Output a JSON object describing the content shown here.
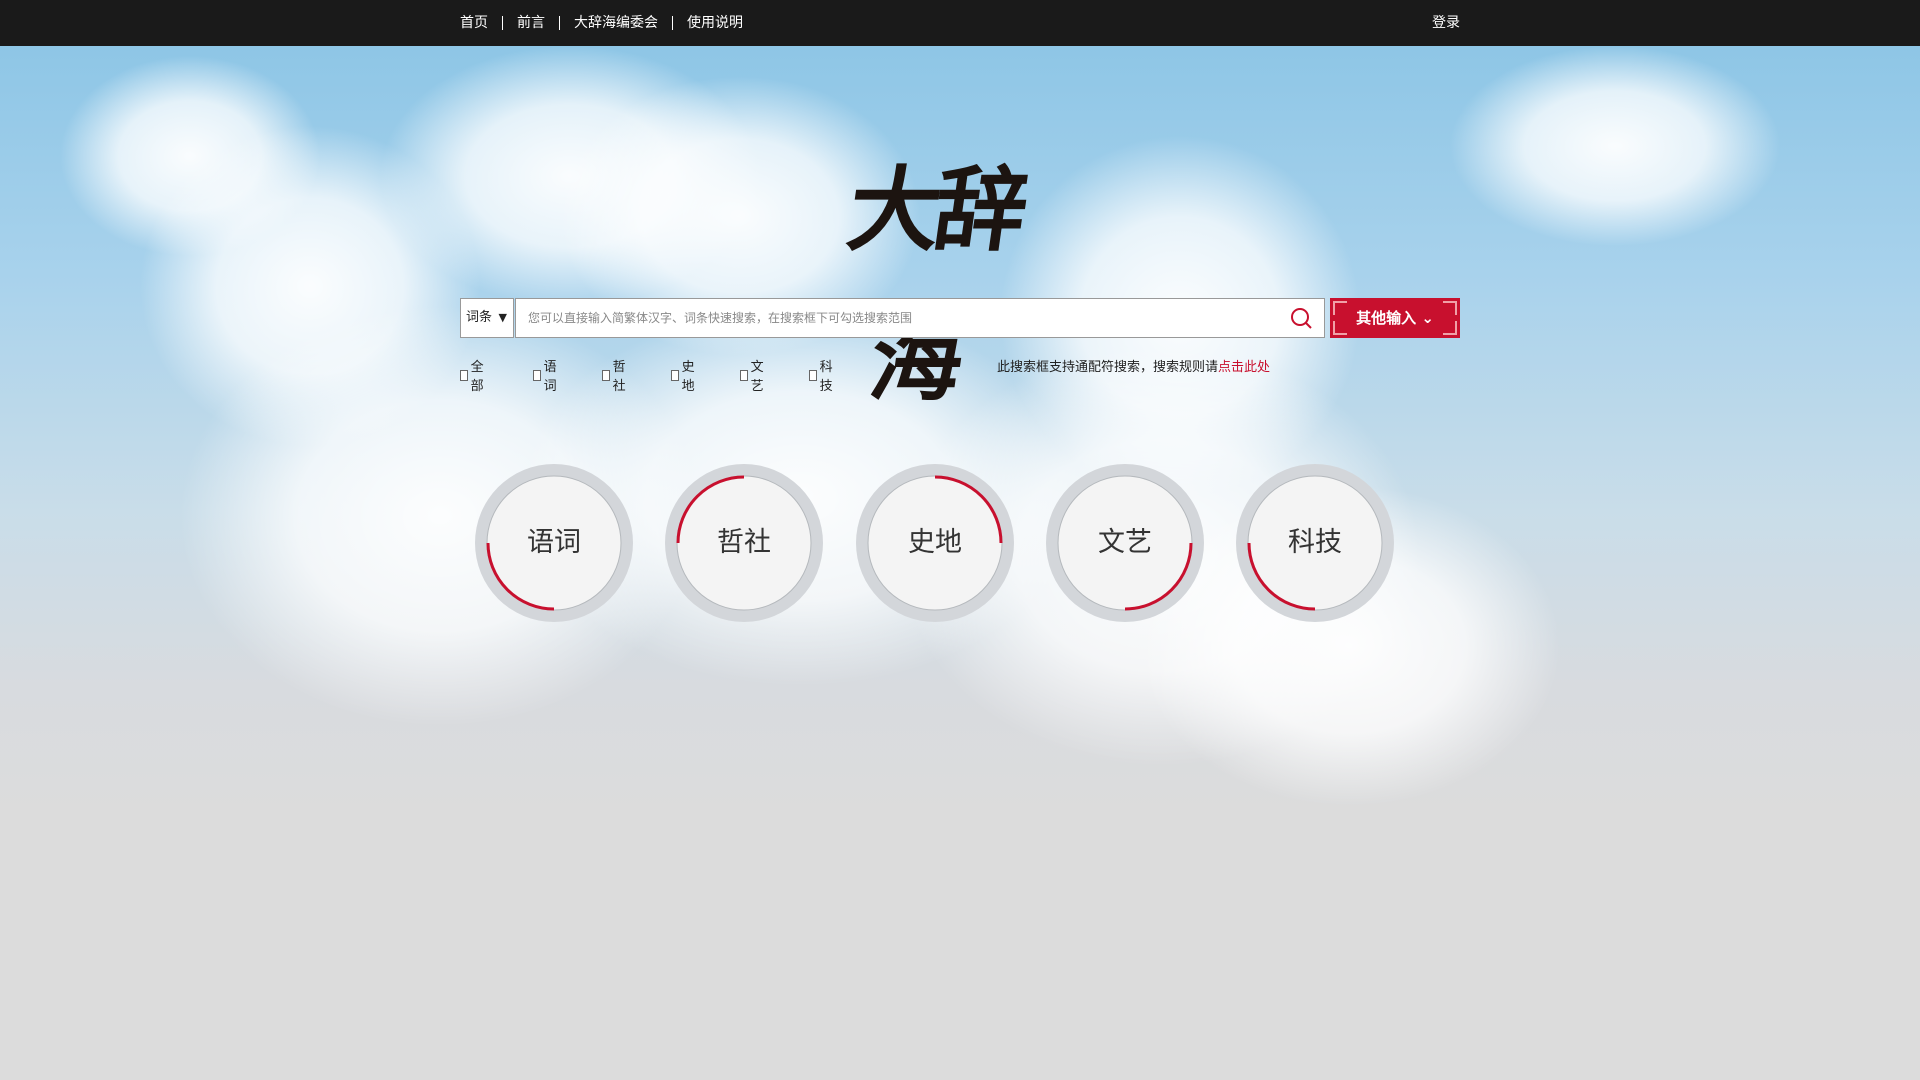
{
  "nav": {
    "items": [
      "首页",
      "前言",
      "大辞海编委会",
      "使用说明"
    ],
    "login": "登录"
  },
  "logo": {
    "text": "大辞海"
  },
  "search": {
    "scope_value": "词条",
    "placeholder": "您可以直接输入简繁体汉字、词条快速搜索，在搜索框下可勾选搜索范围",
    "other_input_label": "其他输入"
  },
  "filters": [
    "全部",
    "语词",
    "哲社",
    "史地",
    "文艺",
    "科技"
  ],
  "hint": {
    "text": "此搜索框支持通配符搜索，搜索规则请",
    "link": "点击此处"
  },
  "categories": [
    "语词",
    "哲社",
    "史地",
    "文艺",
    "科技"
  ],
  "colors": {
    "accent": "#c8102e",
    "topbar": "#1a1a1a"
  },
  "icons": {
    "search": "search-icon",
    "dropdown": "chevron-down-icon"
  }
}
